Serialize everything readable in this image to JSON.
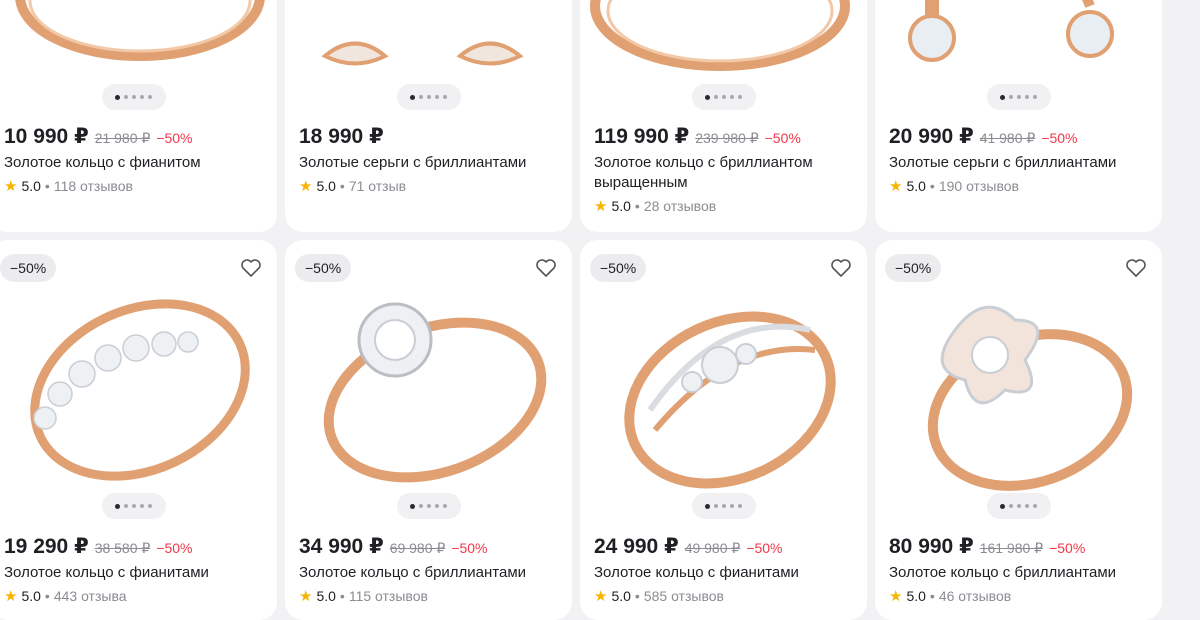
{
  "currency": "₽",
  "row1": [
    {
      "price": "10 990 ₽",
      "old_price": "21 980 ₽",
      "discount": "−50%",
      "title": "Золотое кольцо с фианитом",
      "rating": "5.0",
      "reviews": "118 отзывов",
      "icon": "gold-ring-image"
    },
    {
      "price": "18 990 ₽",
      "old_price": "",
      "discount": "",
      "title": "Золотые серьги с бриллиантами",
      "rating": "5.0",
      "reviews": "71 отзыв",
      "icon": "gold-earrings-image"
    },
    {
      "price": "119 990 ₽",
      "old_price": "239 980 ₽",
      "discount": "−50%",
      "title": "Золотое кольцо с бриллиантом выращенным",
      "rating": "5.0",
      "reviews": "28 отзывов",
      "icon": "gold-ring-image"
    },
    {
      "price": "20 990 ₽",
      "old_price": "41 980 ₽",
      "discount": "−50%",
      "title": "Золотые серьги с бриллиантами",
      "rating": "5.0",
      "reviews": "190 отзывов",
      "icon": "gold-earrings-image"
    }
  ],
  "row2": [
    {
      "badge": "−50%",
      "price": "19 290 ₽",
      "old_price": "38 580 ₽",
      "discount": "−50%",
      "title": "Золотое кольцо с фианитами",
      "rating": "5.0",
      "reviews": "443 отзыва",
      "icon": "eternity-ring-image"
    },
    {
      "badge": "−50%",
      "price": "34 990 ₽",
      "old_price": "69 980 ₽",
      "discount": "−50%",
      "title": "Золотое кольцо с бриллиантами",
      "rating": "5.0",
      "reviews": "115 отзывов",
      "icon": "halo-ring-image"
    },
    {
      "badge": "−50%",
      "price": "24 990 ₽",
      "old_price": "49 980 ₽",
      "discount": "−50%",
      "title": "Золотое кольцо с фианитами",
      "rating": "5.0",
      "reviews": "585 отзывов",
      "icon": "twisted-ring-image"
    },
    {
      "badge": "−50%",
      "price": "80 990 ₽",
      "old_price": "161 980 ₽",
      "discount": "−50%",
      "title": "Золотое кольцо с бриллиантами",
      "rating": "5.0",
      "reviews": "46 отзывов",
      "icon": "clover-ring-image"
    }
  ],
  "colors": {
    "background": "#f2f2f4",
    "card": "#ffffff",
    "discount": "#f2374a",
    "star": "#f7b500",
    "muted": "#8b8b92",
    "gold": "#e8a87c"
  }
}
